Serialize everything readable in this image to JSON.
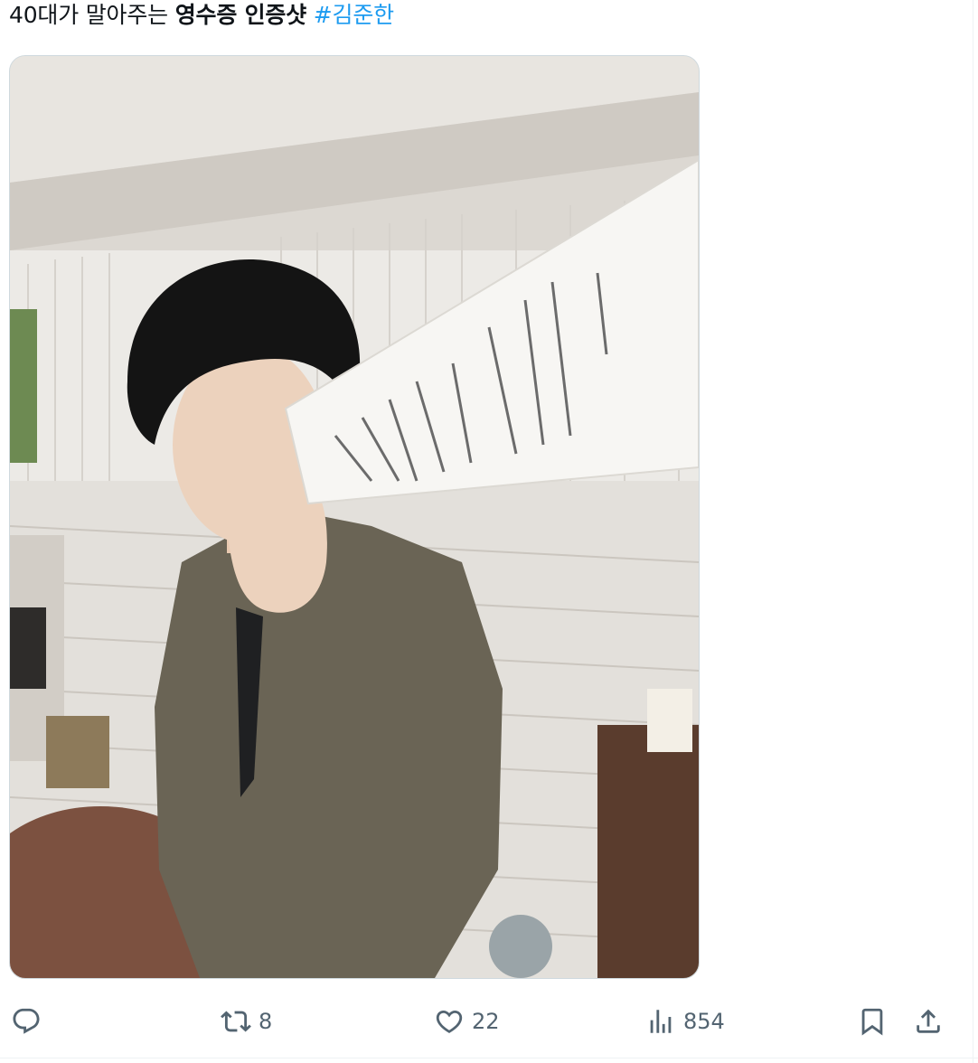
{
  "tweet": {
    "text_plain": "40대가 말아주는 ",
    "text_bold": "영수증 인증샷",
    "text_space": " ",
    "hashtag": "#김준한"
  },
  "media": {
    "alt": "photo"
  },
  "actions": {
    "reply_count": "",
    "retweet_count": "8",
    "like_count": "22",
    "views_count": "854"
  },
  "icons": {
    "reply": "reply-icon",
    "retweet": "retweet-icon",
    "like": "heart-icon",
    "views": "views-icon",
    "bookmark": "bookmark-icon",
    "share": "share-icon"
  },
  "colors": {
    "hashtag": "#1d9bf0",
    "action_gray": "#536471",
    "text": "#0f1419"
  }
}
